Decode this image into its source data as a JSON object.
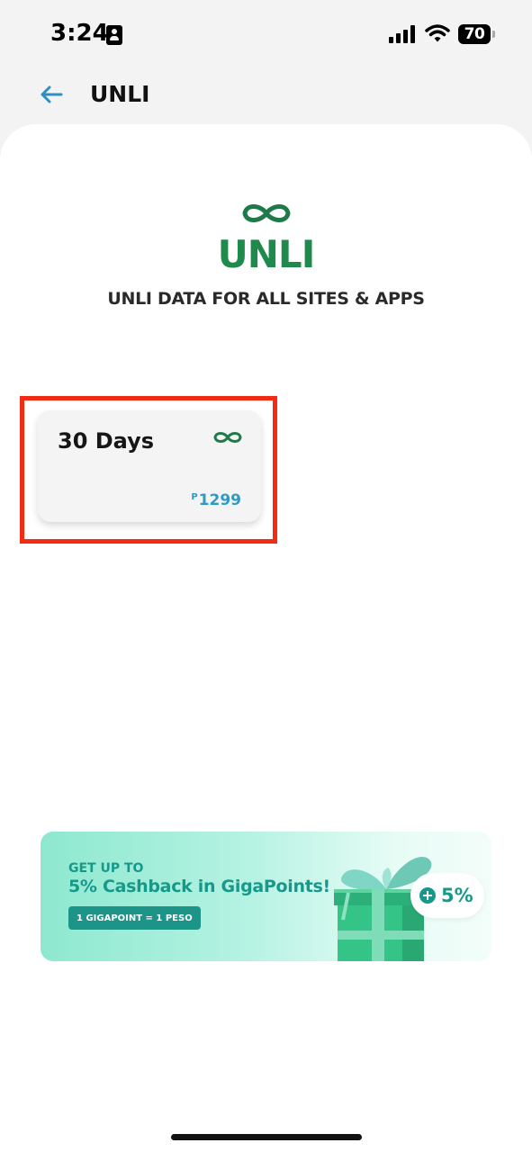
{
  "status_bar": {
    "time": "3:24",
    "battery_level": "70",
    "icons": [
      "id-card-icon",
      "signal-icon",
      "wifi-icon",
      "battery-icon"
    ]
  },
  "header": {
    "back_icon": "arrow-left-icon",
    "title": "UNLI"
  },
  "hero": {
    "icon": "infinity-icon",
    "title": "UNLI",
    "subtitle": "UNLI DATA FOR ALL SITES & APPS"
  },
  "plans": [
    {
      "duration": "30 Days",
      "icon": "infinity-icon",
      "currency": "P",
      "price": "1299"
    }
  ],
  "promo": {
    "kicker": "GET UP TO",
    "headline": "5% Cashback in GigaPoints!",
    "pill": "1 GIGAPOINT = 1 PESO",
    "badge_value": "5%",
    "illustration": "gift-box-icon"
  },
  "colors": {
    "brand_green": "#1f8a4c",
    "accent_blue": "#2f9bc4",
    "promo_teal": "#16998a",
    "highlight_red": "#f42b13",
    "back_arrow": "#2f8fc4"
  }
}
